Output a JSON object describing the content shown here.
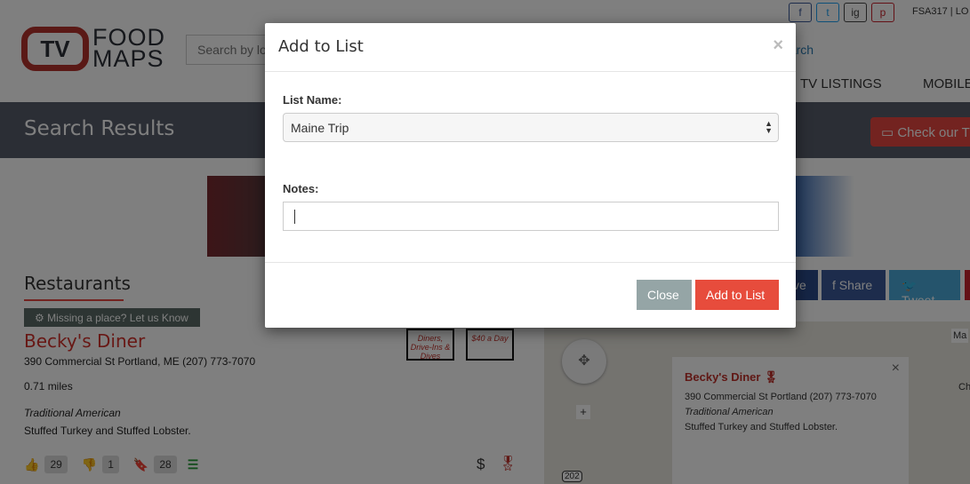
{
  "header": {
    "logo_tv": "TV",
    "logo_line1": "FOOD",
    "logo_line2": "MAPS",
    "search_placeholder": "Search by lo",
    "search_link": "earch",
    "user": "FSA317 | LO",
    "nav": [
      "TV LISTINGS",
      "MOBILE"
    ],
    "social": [
      "f",
      "t",
      "ig",
      "p"
    ]
  },
  "bar": {
    "title": "Search Results",
    "check_button": "Check our T"
  },
  "restaurants": {
    "heading": "Restaurants",
    "missing": "⚙ Missing a place? Let us Know",
    "item": {
      "name": "Becky's Diner",
      "address": "390 Commercial St Portland, ME (207) 773-7070",
      "distance": "0.71 miles",
      "cuisine": "Traditional American",
      "dish": "Stuffed Turkey and Stuffed Lobster.",
      "likes": "29",
      "dislikes": "1",
      "saves": "28",
      "price": "$",
      "shows": [
        "Diners, Drive-Ins & Dives",
        "$40 a Day"
      ]
    }
  },
  "share": {
    "save": "ve",
    "facebook": "f Share",
    "twitter": "Tweet"
  },
  "map": {
    "type_button": "Ma",
    "place_label": "Ch",
    "route": "202",
    "info": {
      "name": "Becky's Diner",
      "address": "390 Commercial St Portland (207) 773-7070",
      "cuisine": "Traditional American",
      "dish": "Stuffed Turkey and Stuffed Lobster.",
      "close": "×"
    }
  },
  "modal": {
    "title": "Add to List",
    "close_x": "×",
    "list_label": "List Name:",
    "list_value": "Maine Trip",
    "notes_label": "Notes:",
    "notes_value": "",
    "close_button": "Close",
    "add_button": "Add to List",
    "colors": {
      "add": "#e74c3c",
      "close": "#95a5a6"
    }
  }
}
